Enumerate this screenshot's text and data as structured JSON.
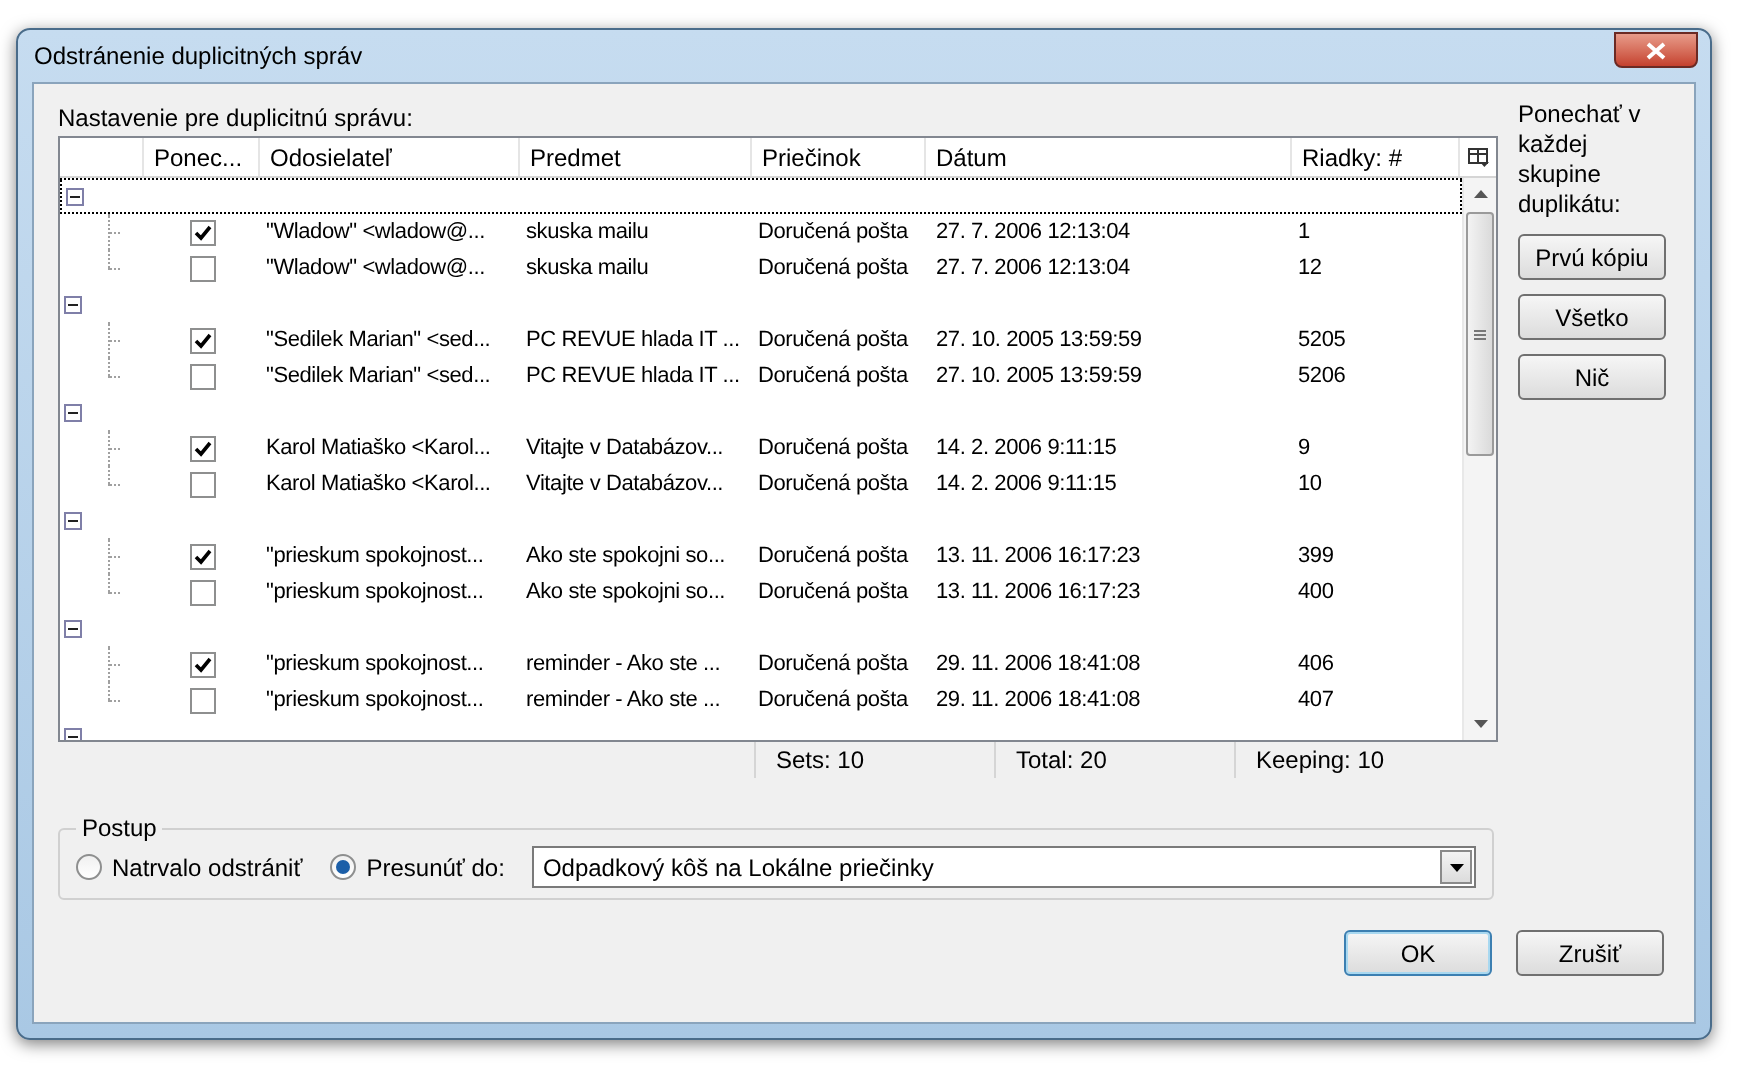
{
  "window": {
    "title": "Odstránenie duplicitných správ"
  },
  "settings_label": "Nastavenie pre duplicitnú správu:",
  "table": {
    "columns": [
      "Ponec...",
      "Odosielateľ",
      "Predmet",
      "Priečinok",
      "Dátum",
      "Riadky: #"
    ],
    "groups": [
      {
        "expanded": true,
        "focused": true,
        "rows": [
          {
            "keep": true,
            "sender": "\"Wladow\" <wladow@...",
            "subject": "skuska mailu",
            "folder": "Doručená pošta",
            "date": "27. 7. 2006 12:13:04",
            "line": "1"
          },
          {
            "keep": false,
            "sender": "\"Wladow\" <wladow@...",
            "subject": "skuska mailu",
            "folder": "Doručená pošta",
            "date": "27. 7. 2006 12:13:04",
            "line": "12"
          }
        ]
      },
      {
        "expanded": true,
        "focused": false,
        "rows": [
          {
            "keep": true,
            "sender": "\"Sedilek Marian\" <sed...",
            "subject": "PC REVUE hlada IT ...",
            "folder": "Doručená pošta",
            "date": "27. 10. 2005 13:59:59",
            "line": "5205"
          },
          {
            "keep": false,
            "sender": "\"Sedilek Marian\" <sed...",
            "subject": "PC REVUE hlada IT ...",
            "folder": "Doručená pošta",
            "date": "27. 10. 2005 13:59:59",
            "line": "5206"
          }
        ]
      },
      {
        "expanded": true,
        "focused": false,
        "rows": [
          {
            "keep": true,
            "sender": "Karol Matiaško <Karol...",
            "subject": "Vitajte v Databázov...",
            "folder": "Doručená pošta",
            "date": "14. 2. 2006 9:11:15",
            "line": "9"
          },
          {
            "keep": false,
            "sender": "Karol Matiaško <Karol...",
            "subject": "Vitajte v Databázov...",
            "folder": "Doručená pošta",
            "date": "14. 2. 2006 9:11:15",
            "line": "10"
          }
        ]
      },
      {
        "expanded": true,
        "focused": false,
        "rows": [
          {
            "keep": true,
            "sender": "\"prieskum spokojnost...",
            "subject": "Ako ste spokojni so...",
            "folder": "Doručená pošta",
            "date": "13. 11. 2006 16:17:23",
            "line": "399"
          },
          {
            "keep": false,
            "sender": "\"prieskum spokojnost...",
            "subject": "Ako ste spokojni so...",
            "folder": "Doručená pošta",
            "date": "13. 11. 2006 16:17:23",
            "line": "400"
          }
        ]
      },
      {
        "expanded": true,
        "focused": false,
        "rows": [
          {
            "keep": true,
            "sender": "\"prieskum spokojnost...",
            "subject": "reminder - Ako ste ...",
            "folder": "Doručená pošta",
            "date": "29. 11. 2006 18:41:08",
            "line": "406"
          },
          {
            "keep": false,
            "sender": "\"prieskum spokojnost...",
            "subject": "reminder - Ako ste ...",
            "folder": "Doručená pošta",
            "date": "29. 11. 2006 18:41:08",
            "line": "407"
          }
        ]
      },
      {
        "expanded": true,
        "focused": false
      }
    ]
  },
  "status_bar": [
    "Sets: 10",
    "Total: 20",
    "Keeping: 10"
  ],
  "keep_panel": {
    "label": "Ponechať v každej skupine duplikátu:",
    "buttons": [
      "Prvú kópiu",
      "Všetko",
      "Nič"
    ]
  },
  "procedure": {
    "title": "Postup",
    "options": [
      {
        "label": "Natrvalo odstrániť",
        "selected": false
      },
      {
        "label": "Presunúť do:",
        "selected": true
      }
    ],
    "target_folder": "Odpadkový kôš na Lokálne priečinky"
  },
  "buttons": [
    {
      "label": "OK",
      "default": true
    },
    {
      "label": "Zrušiť",
      "default": false
    }
  ]
}
